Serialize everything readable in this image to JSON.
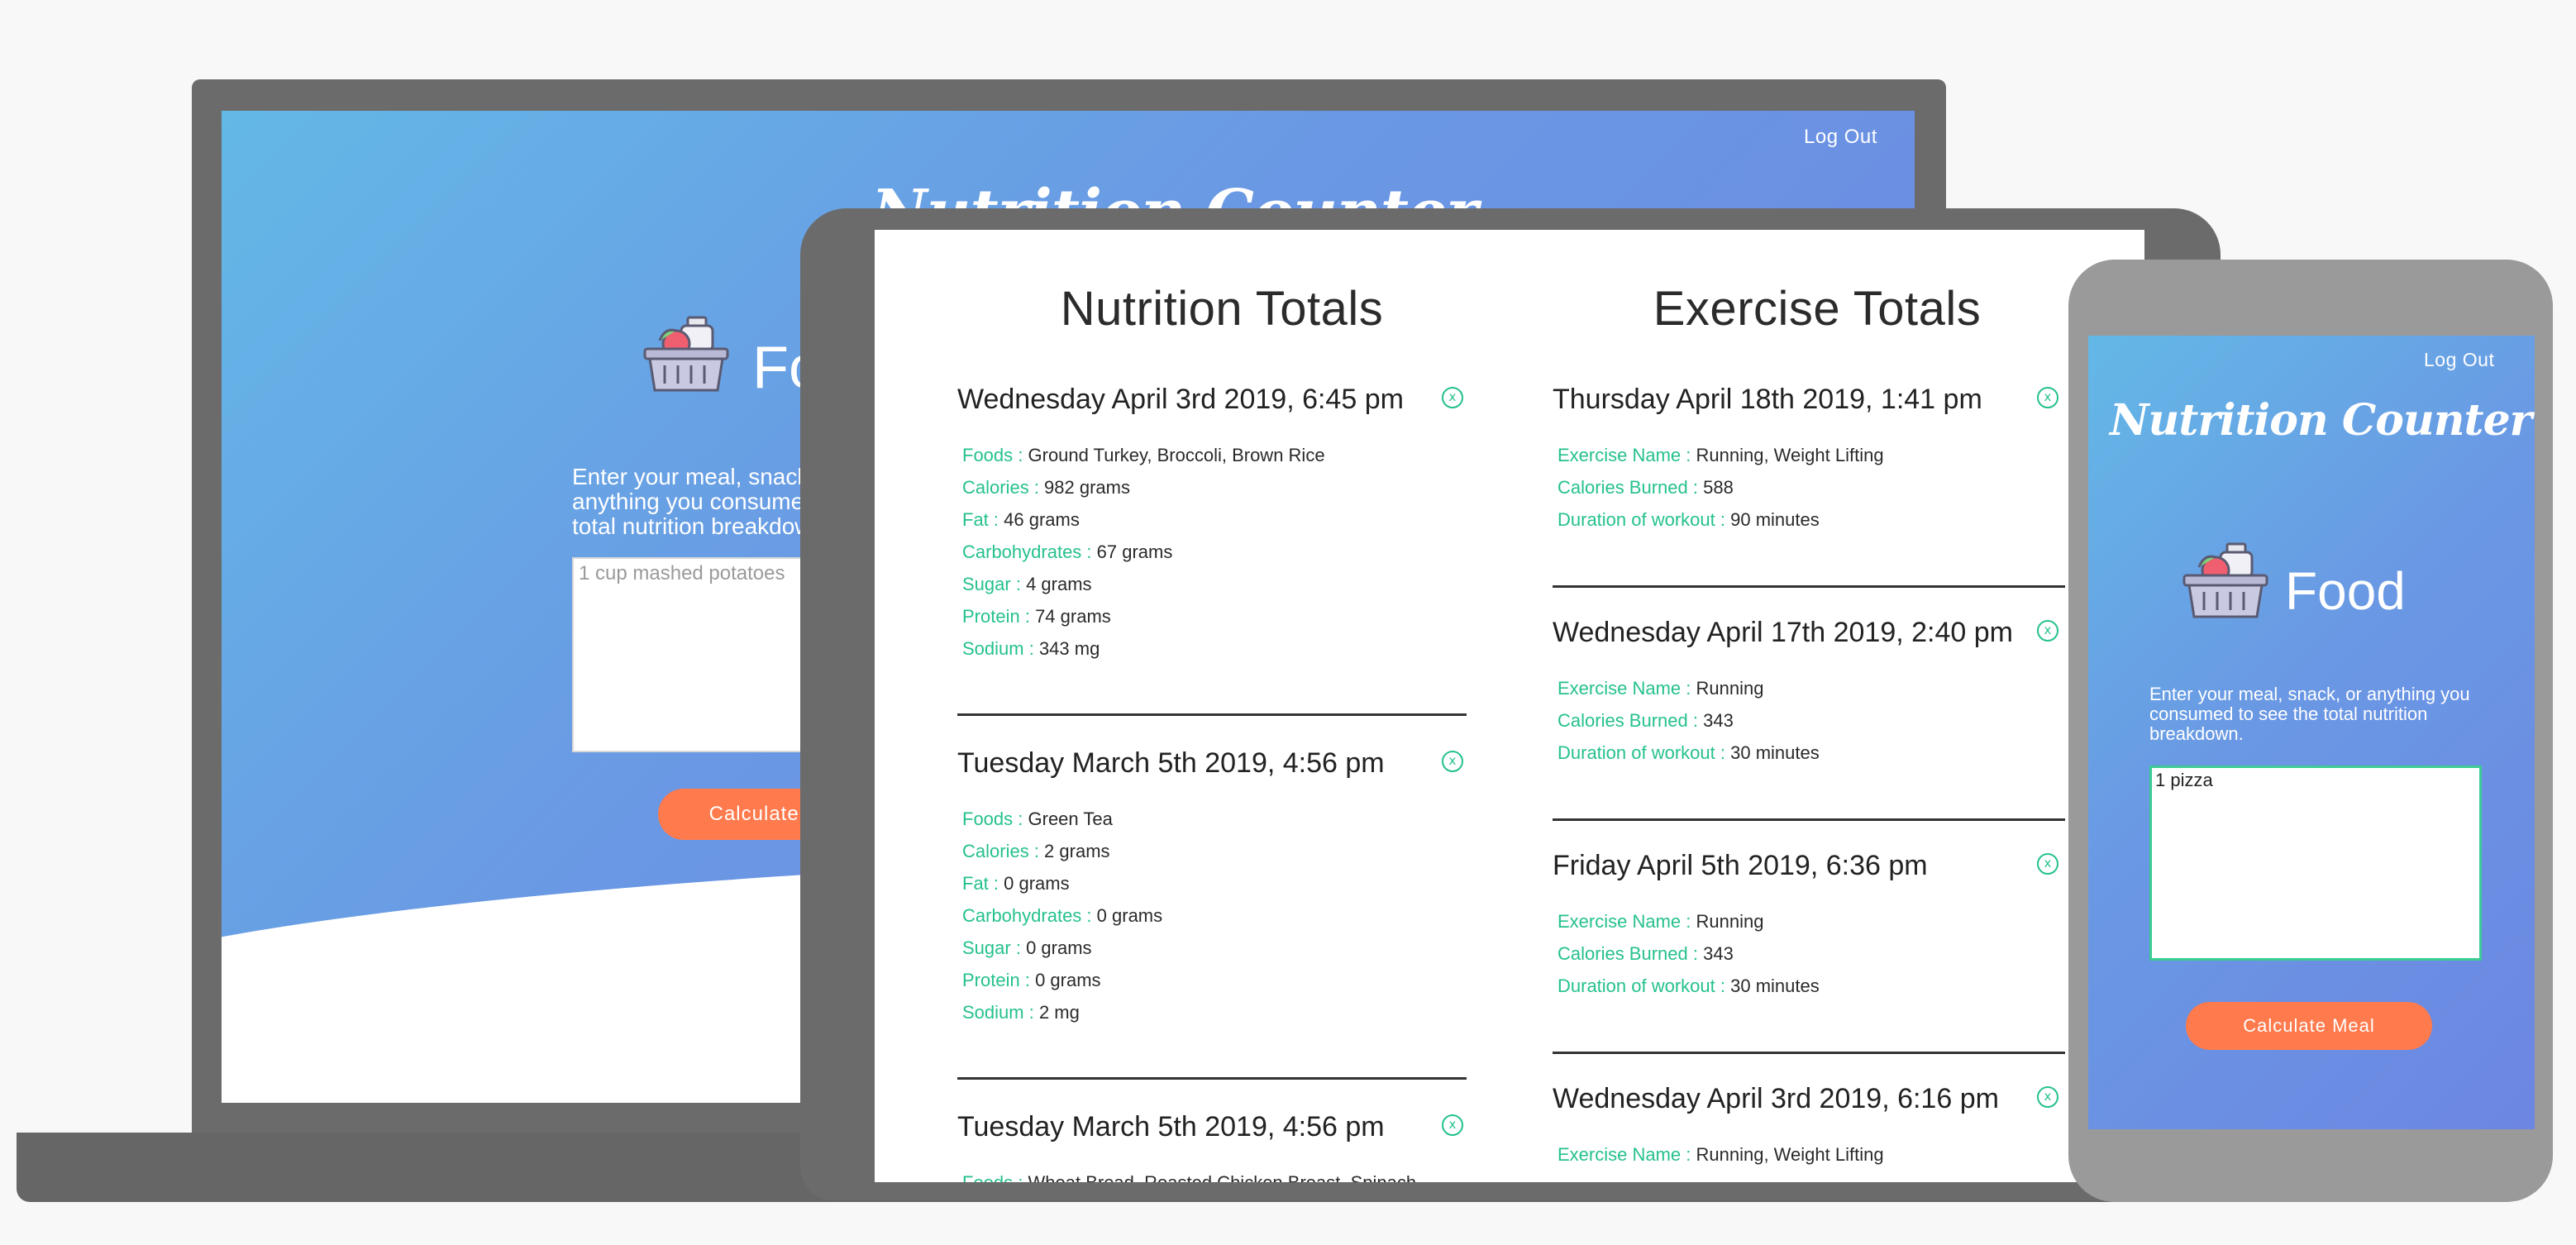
{
  "laptop": {
    "logout_label": "Log Out",
    "app_title": "Nutrition Counter",
    "section_title": "Food",
    "instructions": "Enter your meal, snack, or anything you consumed to see the total nutrition breakdown.",
    "meal_placeholder": "1 cup mashed potatoes",
    "calculate_label": "Calculate Meal"
  },
  "tablet": {
    "nutrition": {
      "title": "Nutrition Totals",
      "entries": [
        {
          "date": "Wednesday April 3rd 2019, 6:45 pm",
          "fields": [
            {
              "key": "Foods",
              "value": "Ground Turkey, Broccoli, Brown Rice"
            },
            {
              "key": "Calories",
              "value": "982 grams"
            },
            {
              "key": "Fat",
              "value": "46 grams"
            },
            {
              "key": "Carbohydrates",
              "value": "67 grams"
            },
            {
              "key": "Sugar",
              "value": "4 grams"
            },
            {
              "key": "Protein",
              "value": "74 grams"
            },
            {
              "key": "Sodium",
              "value": "343 mg"
            }
          ]
        },
        {
          "date": "Tuesday March 5th 2019, 4:56 pm",
          "fields": [
            {
              "key": "Foods",
              "value": "Green Tea"
            },
            {
              "key": "Calories",
              "value": "2 grams"
            },
            {
              "key": "Fat",
              "value": "0 grams"
            },
            {
              "key": "Carbohydrates",
              "value": "0 grams"
            },
            {
              "key": "Sugar",
              "value": "0 grams"
            },
            {
              "key": "Protein",
              "value": "0 grams"
            },
            {
              "key": "Sodium",
              "value": "2 mg"
            }
          ]
        },
        {
          "date": "Tuesday March 5th 2019, 4:56 pm",
          "fields": [
            {
              "key": "Foods",
              "value": "Wheat Bread, Roasted Chicken Breast, Spinach"
            }
          ]
        }
      ]
    },
    "exercise": {
      "title": "Exercise Totals",
      "entries": [
        {
          "date": "Thursday April 18th 2019, 1:41 pm",
          "fields": [
            {
              "key": "Exercise Name",
              "value": "Running, Weight Lifting"
            },
            {
              "key": "Calories Burned",
              "value": "588"
            },
            {
              "key": "Duration of workout",
              "value": "90 minutes"
            }
          ]
        },
        {
          "date": "Wednesday April 17th 2019, 2:40 pm",
          "fields": [
            {
              "key": "Exercise Name",
              "value": "Running"
            },
            {
              "key": "Calories Burned",
              "value": "343"
            },
            {
              "key": "Duration of workout",
              "value": "30 minutes"
            }
          ]
        },
        {
          "date": "Friday April 5th 2019, 6:36 pm",
          "fields": [
            {
              "key": "Exercise Name",
              "value": "Running"
            },
            {
              "key": "Calories Burned",
              "value": "343"
            },
            {
              "key": "Duration of workout",
              "value": "30 minutes"
            }
          ]
        },
        {
          "date": "Wednesday April 3rd 2019, 6:16 pm",
          "fields": [
            {
              "key": "Exercise Name",
              "value": "Running, Weight Lifting"
            }
          ]
        }
      ]
    }
  },
  "phone": {
    "logout_label": "Log Out",
    "app_title": "Nutrition Counter",
    "section_title": "Food",
    "instructions": "Enter your meal, snack, or anything you consumed to see the total nutrition breakdown.",
    "meal_value": "1 pizza",
    "calculate_label": "Calculate Meal"
  },
  "icons": {
    "basket": "food-basket-icon",
    "close": "close-circle-icon"
  },
  "colors": {
    "gradient_start": "#63b8e6",
    "gradient_end": "#6c86e2",
    "accent_green": "#25c18c",
    "button_orange": "#ff7a4d",
    "device_gray": "#6b6b6b"
  }
}
